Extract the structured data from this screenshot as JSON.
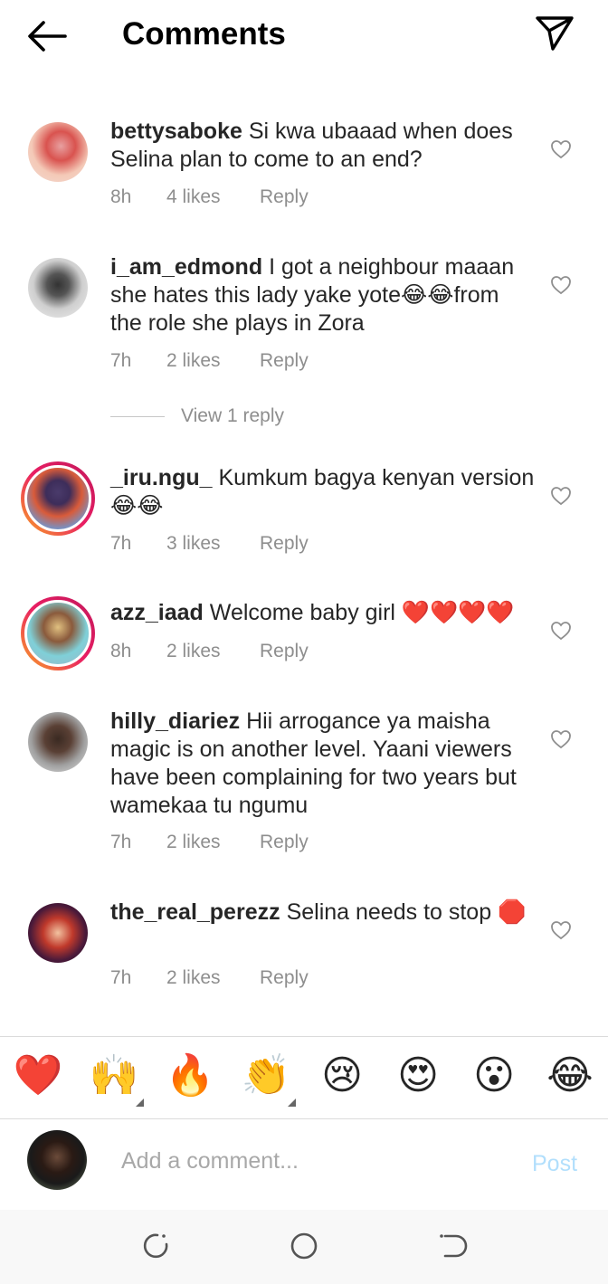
{
  "header": {
    "title": "Comments",
    "back_icon": "arrow-left-icon",
    "share_icon": "paper-plane-icon"
  },
  "comments": [
    {
      "username": "bettysaboke",
      "text": "Si kwa ubaaad when does Selina plan to come to an end?",
      "time": "8h",
      "likes": "4 likes",
      "reply": "Reply"
    },
    {
      "username": "i_am_edmond",
      "text": "I got a neighbour maaan she hates this lady yake yote😂😂from the role she plays in Zora",
      "time": "7h",
      "likes": "2 likes",
      "reply": "Reply",
      "view_replies": "View 1 reply"
    },
    {
      "username": "_iru.ngu_",
      "text": "Kumkum bagya kenyan version😂😂",
      "time": "7h",
      "likes": "3 likes",
      "reply": "Reply"
    },
    {
      "username": "azz_iaad",
      "text": "Welcome baby girl ❤️❤️❤️❤️",
      "time": "8h",
      "likes": "2 likes",
      "reply": "Reply"
    },
    {
      "username": "hilly_diariez",
      "text": "Hii arrogance ya maisha magic is on another level. Yaani viewers have been complaining for two years but wamekaa tu ngumu",
      "time": "7h",
      "likes": "2 likes",
      "reply": "Reply"
    },
    {
      "username": "the_real_perezz",
      "text": "Selina needs to stop 🛑",
      "time": "7h",
      "likes": "2 likes",
      "reply": "Reply"
    }
  ],
  "emojis": [
    "❤️",
    "🙌",
    "🔥",
    "👏",
    "😢",
    "😍",
    "😮",
    "😂"
  ],
  "compose": {
    "placeholder": "Add a comment...",
    "post_label": "Post"
  },
  "colors": {
    "heart_red": "#ed4956",
    "post_blue": "#b2dffc",
    "meta_gray": "#8e8e8e"
  }
}
